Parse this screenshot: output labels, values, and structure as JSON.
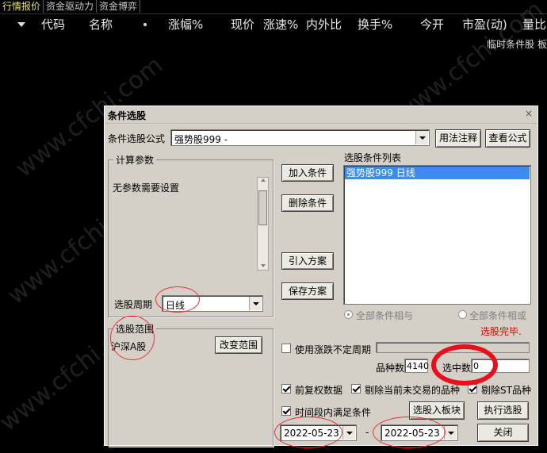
{
  "tabs": [
    "行情报价",
    "资金驱动力",
    "资金博弈"
  ],
  "columns": [
    "代码",
    "名称",
    "涨幅%",
    "现价",
    "涨速%",
    "内外比",
    "换手%",
    "今开",
    "市盈(动)",
    "量比"
  ],
  "sub_info": "临时条件股 板",
  "watermark": "www.cfchi.com",
  "dialog": {
    "title": "条件选股",
    "close": "×",
    "formula_label": "条件选股公式",
    "formula_value": "强势股999   -",
    "usage_button": "用法注释",
    "view_formula_button": "查看公式",
    "params_group": "计算参数",
    "params_text": "无参数需要设置",
    "period_label": "选股周期",
    "period_value": "日线",
    "add_button": "加入条件",
    "delete_button": "删除条件",
    "import_button": "引入方案",
    "save_button": "保存方案",
    "list_label": "选股条件列表",
    "list_items": [
      "强势股999   日线"
    ],
    "radio_and": "全部条件相与",
    "radio_or": "全部条件相或",
    "status_text": "选股完毕.",
    "scope_group": "选股范围",
    "scope_value": "沪深A股",
    "change_scope_button": "改变范围",
    "use_limit_label": "使用涨跌不定周期",
    "count_label": "品种数",
    "count_value": "4140",
    "selected_label": "选中数",
    "selected_value": "0",
    "pre_adjust_label": "前复权数据",
    "exclude_untraded_label": "剔除当前未交易的品种",
    "exclude_st_label": "剔除ST品种",
    "time_range_label": "时间段内满足条件",
    "to_block_button": "选股入板块",
    "execute_button": "执行选股",
    "close_button": "关闭",
    "date_start": "2022-05-23",
    "date_sep": "-",
    "date_end": "2022-05-23"
  },
  "colors": {
    "annotation_red": "#e8303a",
    "header_text": "#e6e6e6",
    "active_tab": "#e9e36a",
    "selected_item_bg": "#3b8bf0"
  }
}
